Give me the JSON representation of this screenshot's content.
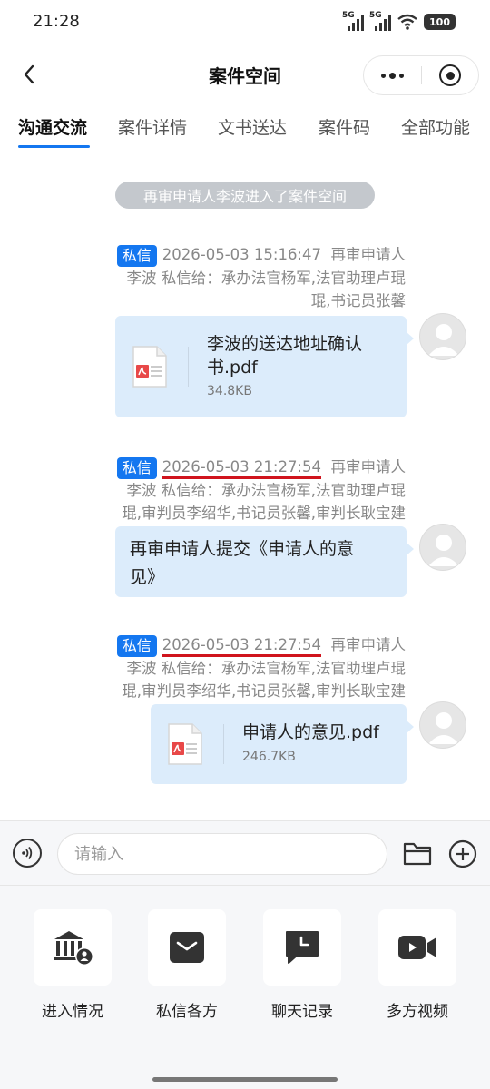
{
  "status_bar": {
    "time": "21:28",
    "signal_label_1": "5G",
    "signal_label_2": "5G",
    "battery": "100"
  },
  "header": {
    "title": "案件空间"
  },
  "tabs": [
    {
      "label": "沟通交流",
      "active": true
    },
    {
      "label": "案件详情",
      "active": false
    },
    {
      "label": "文书送达",
      "active": false
    },
    {
      "label": "案件码",
      "active": false
    },
    {
      "label": "全部功能",
      "active": false
    }
  ],
  "system_message": "再审申请人李波进入了案件空间",
  "messages": [
    {
      "tag": "私信",
      "timestamp": "2026-05-03 15:16:47",
      "sender_role": "再审申请人",
      "sender_line": "李波  私信给：承办法官杨军,法官助理卢琨",
      "recipients_line": "琨,书记员张馨",
      "type": "file",
      "file_name_line1": "李波的送达地址确认",
      "file_name_line2": "书.pdf",
      "file_size": "34.8KB"
    },
    {
      "tag": "私信",
      "timestamp": "2026-05-03 21:27:54",
      "sender_role": "再审申请人",
      "sender_line": "李波  私信给：承办法官杨军,法官助理卢琨",
      "recipients_line": "琨,审判员李绍华,书记员张馨,审判长耿宝建",
      "type": "text",
      "text_line1": "再审申请人提交《申请人的意",
      "text_line2": "见》"
    },
    {
      "tag": "私信",
      "timestamp": "2026-05-03 21:27:54",
      "sender_role": "再审申请人",
      "sender_line": "李波  私信给：承办法官杨军,法官助理卢琨",
      "recipients_line": "琨,审判员李绍华,书记员张馨,审判长耿宝建",
      "type": "file",
      "file_name_line1": "申请人的意见.pdf",
      "file_size": "246.7KB"
    }
  ],
  "input": {
    "placeholder": "请输入"
  },
  "actions": [
    {
      "label": "进入情况",
      "icon": "court-user-icon"
    },
    {
      "label": "私信各方",
      "icon": "envelope-icon"
    },
    {
      "label": "聊天记录",
      "icon": "chat-clock-icon"
    },
    {
      "label": "多方视频",
      "icon": "video-camera-icon"
    }
  ],
  "colors": {
    "accent": "#1477f0",
    "bubble": "#dcecfb",
    "pill": "#c4c8cd",
    "annotation_underline": "#d0141d"
  }
}
